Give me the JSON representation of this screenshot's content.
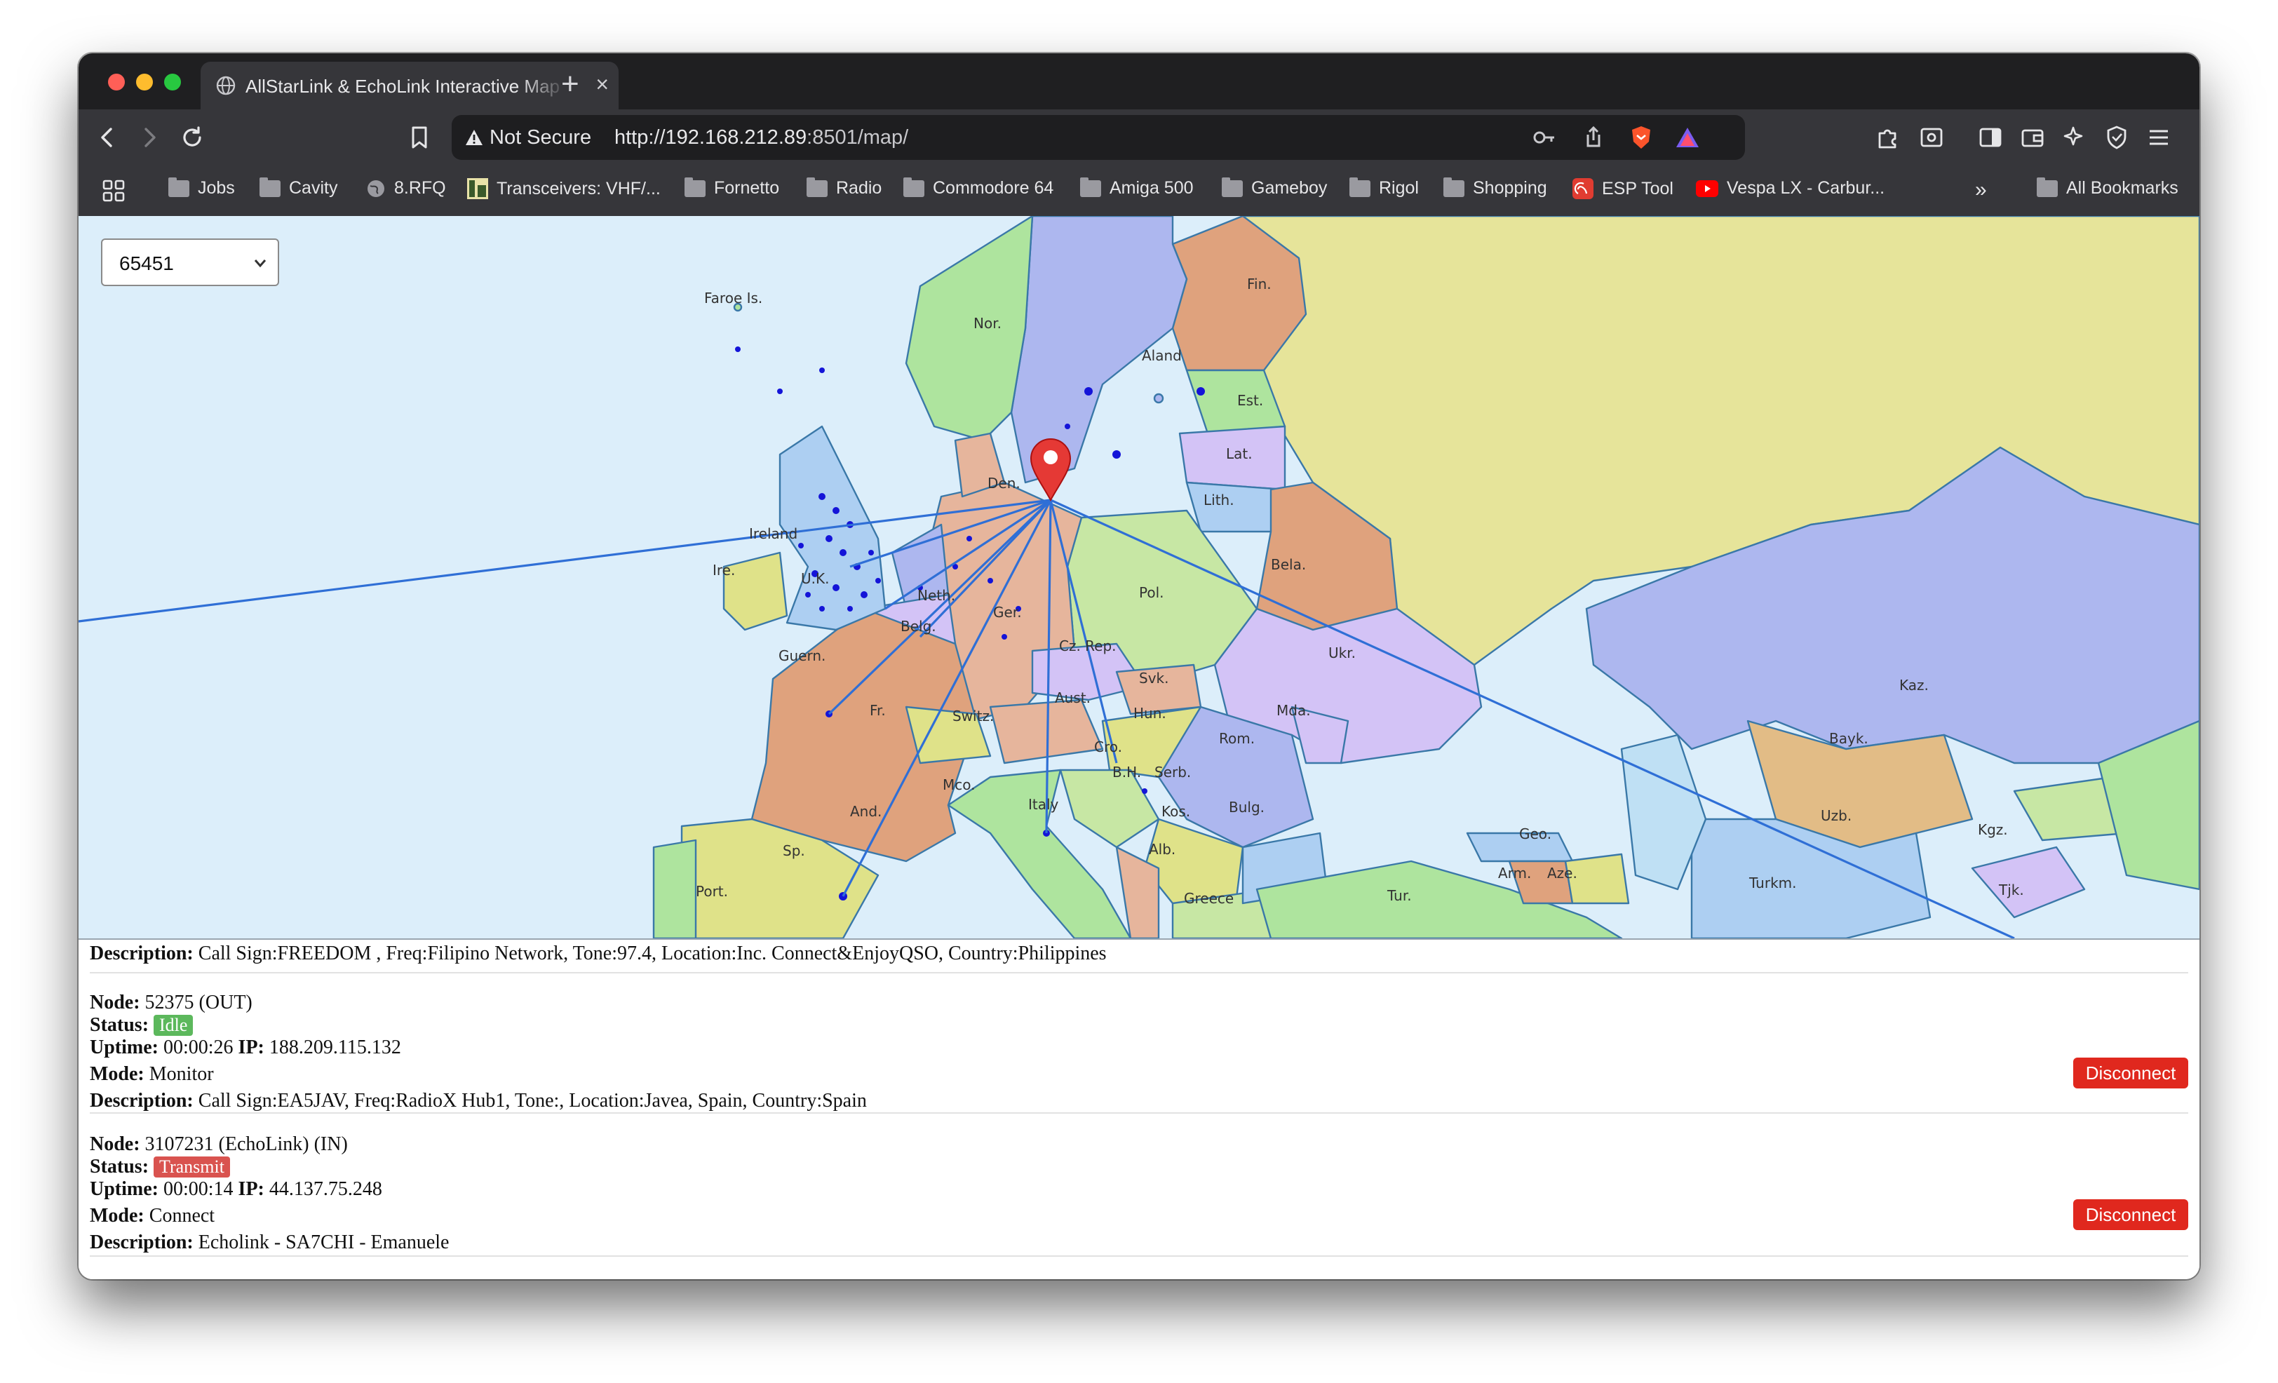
{
  "browser": {
    "tab_title": "AllStarLink & EchoLink Interactive Map",
    "security_label": "Not Secure",
    "url_host": "http://192.168.212.89",
    "url_rest": ":8501/map/",
    "bookmarks": [
      "Jobs",
      "Cavity",
      "8.RFQ",
      "Transceivers: VHF/...",
      "Fornetto",
      "Radio",
      "Commodore 64",
      "Amiga 500",
      "Gameboy",
      "Rigol",
      "Shopping",
      "ESP Tool",
      "Vespa LX - Carbur..."
    ],
    "all_bookmarks": "All Bookmarks",
    "more": "»"
  },
  "colors": {
    "idle": "#5cb85c",
    "transmit": "#d9534f",
    "disconnect": "#e0281e",
    "link_line": "#2f6fd6",
    "marker": "#e53935"
  },
  "map": {
    "node_select": "65451",
    "labels": [
      "Faroe Is.",
      "Fin.",
      "Nor.",
      "Aland",
      "Est.",
      "Den.",
      "Lat.",
      "Lith.",
      "Ireland",
      "Ire.",
      "U.K.",
      "Neth.",
      "Bela.",
      "Pol.",
      "Ger.",
      "Belg.",
      "Guern.",
      "Cz. Rep.",
      "Ukr.",
      "Svk.",
      "Fr.",
      "Aust.",
      "Hun.",
      "Mda.",
      "Switz.",
      "Rom.",
      "Cro.",
      "B.H.",
      "Serb.",
      "Mco.",
      "Italy",
      "Bulg.",
      "And.",
      "Kos.",
      "Sp.",
      "Alb.",
      "Port.",
      "Greece",
      "Tur.",
      "Geo.",
      "Arm.",
      "Aze.",
      "Kaz.",
      "Bayk.",
      "Uzb.",
      "Kgz.",
      "Turkm.",
      "Tjk."
    ]
  },
  "connections": [
    {
      "description_label": "Description:",
      "description": "Call Sign:FREEDOM , Freq:Filipino Network, Tone:97.4, Location:Inc. Connect&EnjoyQSO, Country:Philippines"
    },
    {
      "node_label": "Node:",
      "node": "52375 (OUT)",
      "status_label": "Status:",
      "status": "Idle",
      "uptime_label": "Uptime:",
      "uptime": "00:00:26",
      "ip_label": "IP:",
      "ip": "188.209.115.132",
      "mode_label": "Mode:",
      "mode": "Monitor",
      "description_label": "Description:",
      "description": "Call Sign:EA5JAV, Freq:RadioX Hub1, Tone:, Location:Javea, Spain, Country:Spain",
      "button": "Disconnect"
    },
    {
      "node_label": "Node:",
      "node": "3107231 (EchoLink) (IN)",
      "status_label": "Status:",
      "status": "Transmit",
      "uptime_label": "Uptime:",
      "uptime": "00:00:14",
      "ip_label": "IP:",
      "ip": "44.137.75.248",
      "mode_label": "Mode:",
      "mode": "Connect",
      "description_label": "Description:",
      "description": "Echolink - SA7CHI - Emanuele",
      "button": "Disconnect"
    }
  ]
}
